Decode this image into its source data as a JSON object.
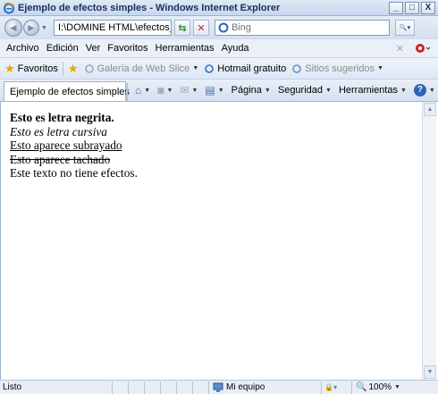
{
  "window": {
    "title": "Ejemplo de efectos simples - Windows Internet Explorer",
    "min_label": "_",
    "max_label": "□",
    "close_label": "X"
  },
  "address": {
    "url": "I:\\DOMINE HTML\\efectos_",
    "search_placeholder": "Bing"
  },
  "menu": {
    "items": [
      "Archivo",
      "Edición",
      "Ver",
      "Favoritos",
      "Herramientas",
      "Ayuda"
    ]
  },
  "favorites": {
    "label": "Favoritos",
    "links": [
      "Galería de Web Slice",
      "Hotmail gratuito",
      "Sitios sugeridos"
    ]
  },
  "tabs": {
    "active": "Ejemplo de efectos simples"
  },
  "commands": {
    "pagina": "Página",
    "seguridad": "Seguridad",
    "herramientas": "Herramientas"
  },
  "content": {
    "lines": [
      "Esto es letra negrita.",
      "Esto es letra cursiva",
      "Esto aparece subrayado",
      "Esto aparece tachado",
      "Este texto no tiene efectos."
    ]
  },
  "status": {
    "text": "Listo",
    "zone": "Mi equipo",
    "zoom": "100%"
  },
  "colors": {
    "chrome": "#dfe9f6",
    "title_text": "#1a2f5a",
    "accent": "#2f63b5"
  }
}
